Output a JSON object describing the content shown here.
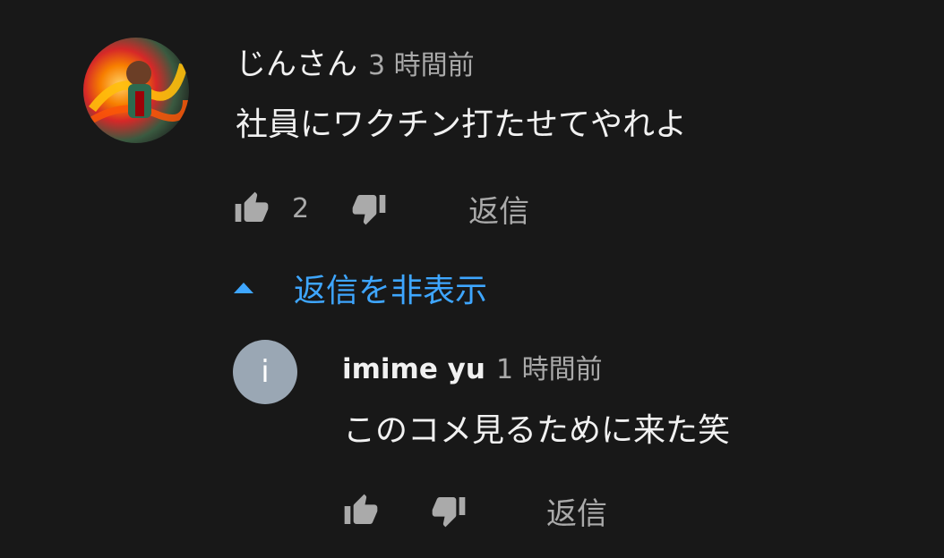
{
  "comment": {
    "author": "じんさん",
    "time": "3 時間前",
    "text": "社員にワクチン打たせてやれよ",
    "like_count": "2",
    "reply_label": "返信"
  },
  "replies_toggle": {
    "label": "返信を非表示"
  },
  "reply": {
    "avatar_letter": "i",
    "author": "imime yu",
    "time": "1 時間前",
    "text": "このコメ見るために来た笑",
    "reply_label": "返信"
  },
  "colors": {
    "background": "#181818",
    "primary_text": "#f1f1f1",
    "secondary_text": "#aaaaaa",
    "link_blue": "#3ea6ff",
    "avatar_letter_bg": "#9aa7b4"
  },
  "icons": [
    "thumbs-up-icon",
    "thumbs-down-icon",
    "caret-up-icon"
  ]
}
